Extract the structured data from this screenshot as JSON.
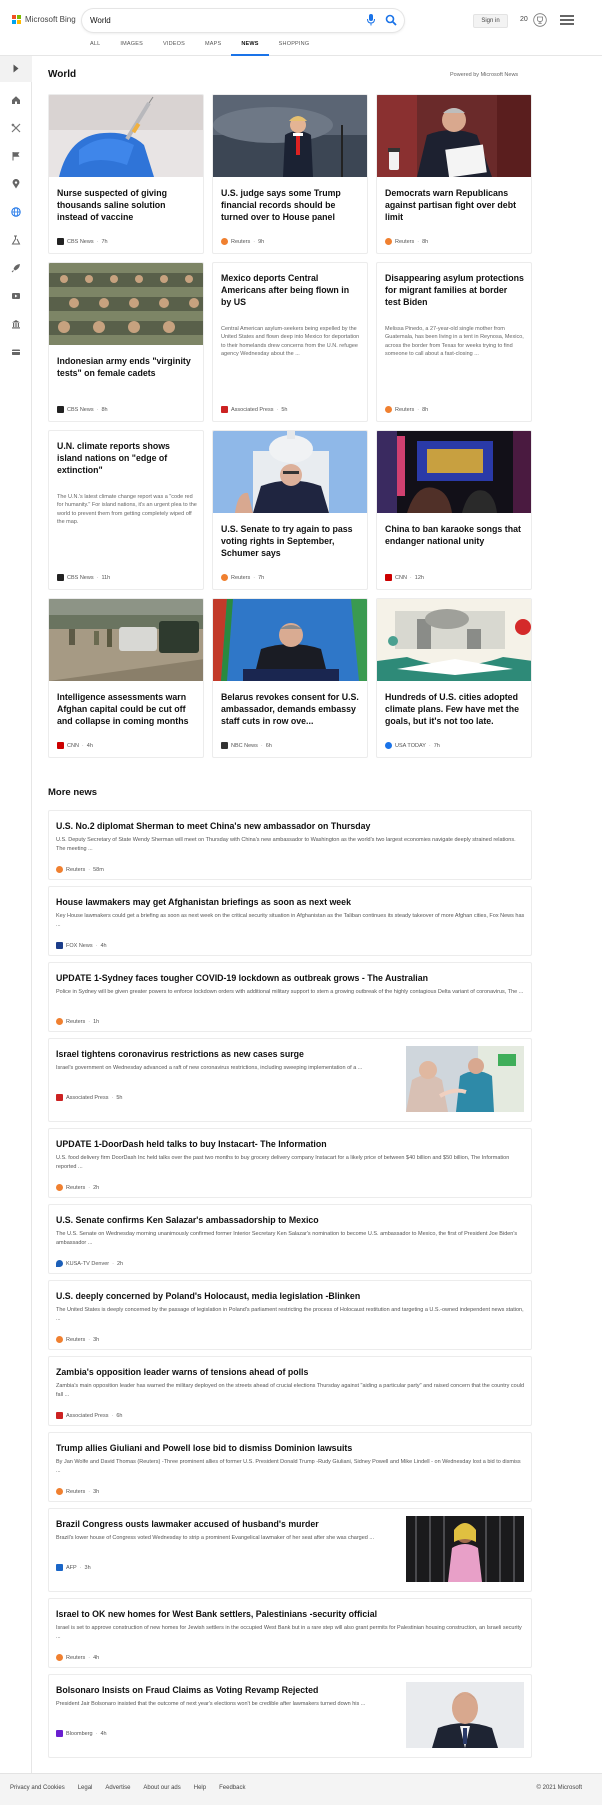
{
  "header": {
    "logo_text": "Microsoft Bing",
    "search_value": "World",
    "signin_label": "Sign in",
    "rewards_count": "20",
    "tabs": [
      "ALL",
      "IMAGES",
      "VIDEOS",
      "MAPS",
      "NEWS",
      "SHOPPING"
    ],
    "active_tab": "NEWS"
  },
  "colors": {
    "accent": "#1a73e8",
    "logo": [
      "#f25022",
      "#7fba00",
      "#00a4ef",
      "#ffb900"
    ]
  },
  "sidebar": {
    "icons": [
      "expand-icon",
      "home-icon",
      "sports-icon",
      "flag-icon",
      "location-icon",
      "globe-icon",
      "science-icon",
      "rocket-icon",
      "video-icon",
      "money-icon",
      "card-icon"
    ]
  },
  "section": {
    "title": "World",
    "powered": "Powered by Microsoft News"
  },
  "cards": [
    {
      "title": "Nurse suspected of giving thousands saline solution instead of vaccine",
      "snippet": "",
      "source": "CBS News",
      "time": "7h",
      "logo": "cbs"
    },
    {
      "title": "U.S. judge says some Trump financial records should be turned over to House panel",
      "snippet": "",
      "source": "Reuters",
      "time": "9h",
      "logo": "reuters"
    },
    {
      "title": "Democrats warn Republicans against partisan fight over debt limit",
      "snippet": "",
      "source": "Reuters",
      "time": "8h",
      "logo": "reuters"
    },
    {
      "title": "Indonesian army ends \"virginity tests\" on female cadets",
      "snippet": "",
      "source": "CBS News",
      "time": "8h",
      "logo": "cbs"
    },
    {
      "title": "Mexico deports Central Americans after being flown in by US",
      "snippet": "Central American asylum-seekers being expelled by the United States and flown deep into Mexico for deportation to their homelands drew concerns from the U.N. refugee agency Wednesday about the ...",
      "source": "Associated Press",
      "time": "5h",
      "logo": "ap"
    },
    {
      "title": "Disappearing asylum protections for migrant families at border test Biden",
      "snippet": "Melissa Pinedo, a 27-year-old single mother from Guatemala, has been living in a tent in Reynosa, Mexico, across the border from Texas for weeks trying to find someone to call about a fast-closing ...",
      "source": "Reuters",
      "time": "8h",
      "logo": "reuters"
    },
    {
      "title": "U.N. climate reports shows island nations on \"edge of extinction\"",
      "snippet": "The U.N.'s latest climate change report was a \"code red for humanity.\" For island nations, it's an urgent plea to the world to prevent them from getting completely wiped off the map.",
      "source": "CBS News",
      "time": "11h",
      "logo": "cbs"
    },
    {
      "title": "U.S. Senate to try again to pass voting rights in September, Schumer says",
      "snippet": "",
      "source": "Reuters",
      "time": "7h",
      "logo": "reuters"
    },
    {
      "title": "China to ban karaoke songs that endanger national unity",
      "snippet": "",
      "source": "CNN",
      "time": "12h",
      "logo": "cnn"
    },
    {
      "title": "Intelligence assessments warn Afghan capital could be cut off and collapse in coming months",
      "snippet": "",
      "source": "CNN",
      "time": "4h",
      "logo": "cnn"
    },
    {
      "title": "Belarus revokes consent for U.S. ambassador, demands embassy staff cuts in row ove...",
      "snippet": "",
      "source": "NBC News",
      "time": "6h",
      "logo": "nbc"
    },
    {
      "title": "Hundreds of U.S. cities adopted climate plans. Few have met the goals, but it's not too late.",
      "snippet": "",
      "source": "USA TODAY",
      "time": "7h",
      "logo": "usatoday"
    }
  ],
  "more_news": {
    "title": "More news",
    "items": [
      {
        "title": "U.S. No.2 diplomat Sherman to meet China's new ambassador on Thursday",
        "snippet": "U.S. Deputy Secretary of State Wendy Sherman will meet on Thursday with China's new ambassador to Washington as the world's two largest economies navigate deeply strained relations. The meeting ...",
        "source": "Reuters",
        "time": "58m",
        "logo": "reuters"
      },
      {
        "title": "House lawmakers may get Afghanistan briefings as soon as next week",
        "snippet": "Key House lawmakers could get a briefing as soon as next week on the critical security situation in Afghanistan as the Taliban continues its steady takeover of more Afghan cities, Fox News has ...",
        "source": "FOX News",
        "time": "4h",
        "logo": "fox"
      },
      {
        "title": "UPDATE 1-Sydney faces tougher COVID-19 lockdown as outbreak grows - The Australian",
        "snippet": "Police in Sydney will be given greater powers to enforce lockdown orders with additional military support to stem a growing outbreak of the highly contagious Delta variant of coronavirus, The ...",
        "source": "Reuters",
        "time": "1h",
        "logo": "reuters"
      },
      {
        "title": "Israel tightens coronavirus restrictions as new cases surge",
        "snippet": "Israel's government on Wednesday advanced a raft of new coronavirus restrictions, including sweeping implementation of a ...",
        "source": "Associated Press",
        "time": "5h",
        "logo": "ap"
      },
      {
        "title": "UPDATE 1-DoorDash held talks to buy Instacart- The Information",
        "snippet": "U.S. food delivery firm DoorDash Inc held talks over the past two months to buy grocery delivery company Instacart for a likely price of between $40 billion and $50 billion, The Information reported ...",
        "source": "Reuters",
        "time": "2h",
        "logo": "reuters"
      },
      {
        "title": "U.S. Senate confirms Ken Salazar's ambassadorship to Mexico",
        "snippet": "The U.S. Senate on Wednesday morning unanimously confirmed former Interior Secretary Ken Salazar's nomination to become U.S. ambassador to Mexico, the first of President Joe Biden's ambassador ...",
        "source": "KUSA-TV Denver",
        "time": "2h",
        "logo": "kusa"
      },
      {
        "title": "U.S. deeply concerned by Poland's Holocaust, media legislation -Blinken",
        "snippet": "The United States is deeply concerned by the passage of legislation in Poland's parliament restricting the process of Holocaust restitution and targeting a U.S.-owned independent news station, ...",
        "source": "Reuters",
        "time": "3h",
        "logo": "reuters"
      },
      {
        "title": "Zambia's opposition leader warns of tensions ahead of polls",
        "snippet": "Zambia's main opposition leader has warned the military deployed on the streets ahead of crucial elections Thursday against \"aiding a particular party\" and raised concern that the country could fall ...",
        "source": "Associated Press",
        "time": "6h",
        "logo": "ap"
      },
      {
        "title": "Trump allies Giuliani and Powell lose bid to dismiss Dominion lawsuits",
        "snippet": "By Jan Wolfe and David Thomas (Reuters) -Three prominent allies of former U.S. President Donald Trump -Rudy Giuliani, Sidney Powell and Mike Lindell - on Wednesday lost a bid to dismiss ...",
        "source": "Reuters",
        "time": "3h",
        "logo": "reuters"
      },
      {
        "title": "Brazil Congress ousts lawmaker accused of husband's murder",
        "snippet": "Brazil's lower house of Congress voted Wednesday to strip a prominent Evangelical lawmaker of her seat after she was charged ...",
        "source": "AFP",
        "time": "3h",
        "logo": "afp"
      },
      {
        "title": "Israel to OK new homes for West Bank settlers, Palestinians -security official",
        "snippet": "Israel is set to approve construction of new homes for Jewish settlers in the occupied West Bank but in a rare step will also grant permits for Palestinian housing construction, an Israeli security ...",
        "source": "Reuters",
        "time": "4h",
        "logo": "reuters"
      },
      {
        "title": "Bolsonaro Insists on Fraud Claims as Voting Revamp Rejected",
        "snippet": "President Jair Bolsonaro insisted that the outcome of next year's elections won't be credible after lawmakers turned down his ...",
        "source": "Bloomberg",
        "time": "4h",
        "logo": "bloomberg"
      }
    ]
  },
  "footer": {
    "links": [
      "Privacy and Cookies",
      "Legal",
      "Advertise",
      "About our ads",
      "Help",
      "Feedback"
    ],
    "copyright": "© 2021 Microsoft"
  }
}
